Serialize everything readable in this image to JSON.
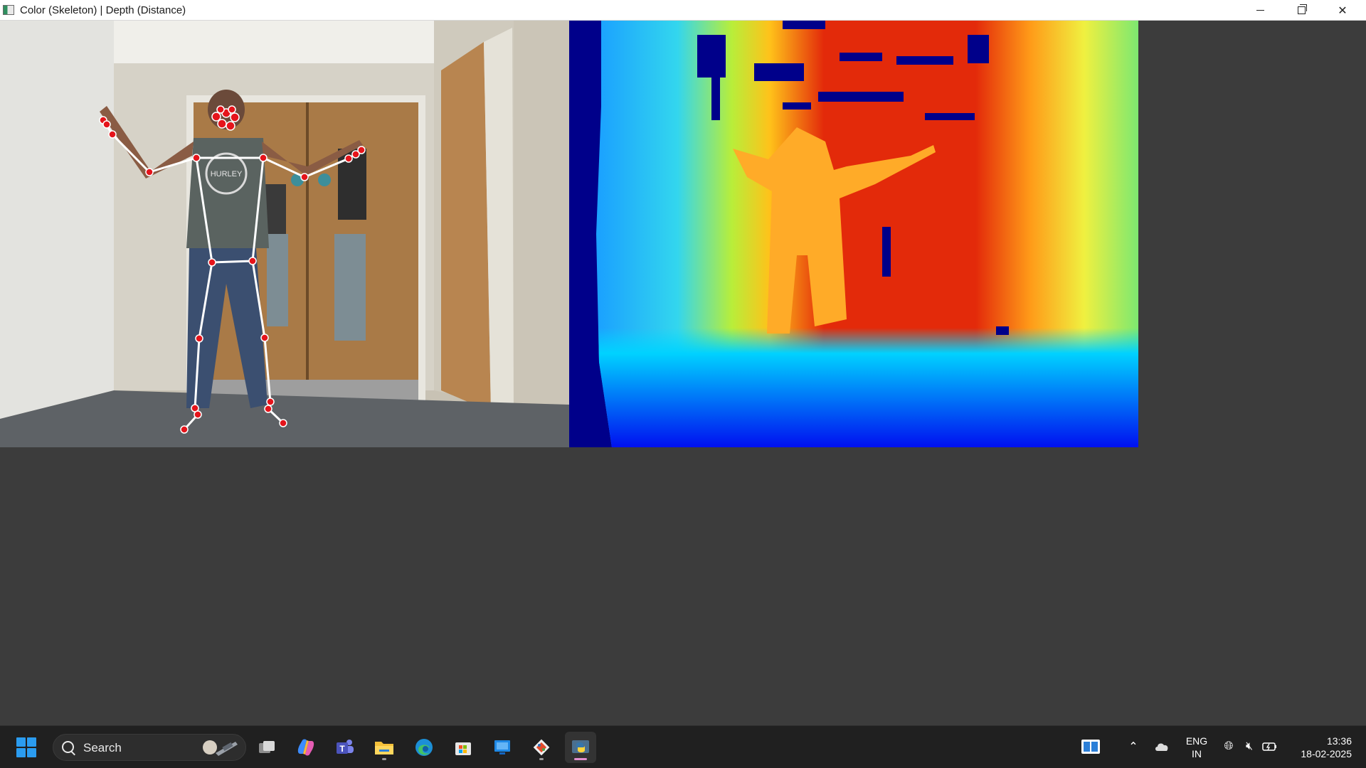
{
  "window": {
    "title": "Color (Skeleton) | Depth (Distance)",
    "controls": [
      "minimize",
      "restore",
      "close"
    ]
  },
  "panels": {
    "left": "color-skeleton-view",
    "right": "depth-distance-view"
  },
  "skeleton": {
    "joint_color": "#e5141b",
    "bone_color": "#ffffff"
  },
  "colors": {
    "canvas_background": "#3c3c3c",
    "depth_background": "#00008a",
    "taskbar": "#202020",
    "accent": "#2b9cf0"
  },
  "taskbar": {
    "search_placeholder": "Search",
    "pinned": [
      "task-view",
      "copilot",
      "teams",
      "file-explorer",
      "edge",
      "microsoft-store",
      "remote-desktop",
      "git",
      "python"
    ],
    "language_line1": "ENG",
    "language_line2": "IN",
    "time": "13:36",
    "date": "18-02-2025"
  }
}
